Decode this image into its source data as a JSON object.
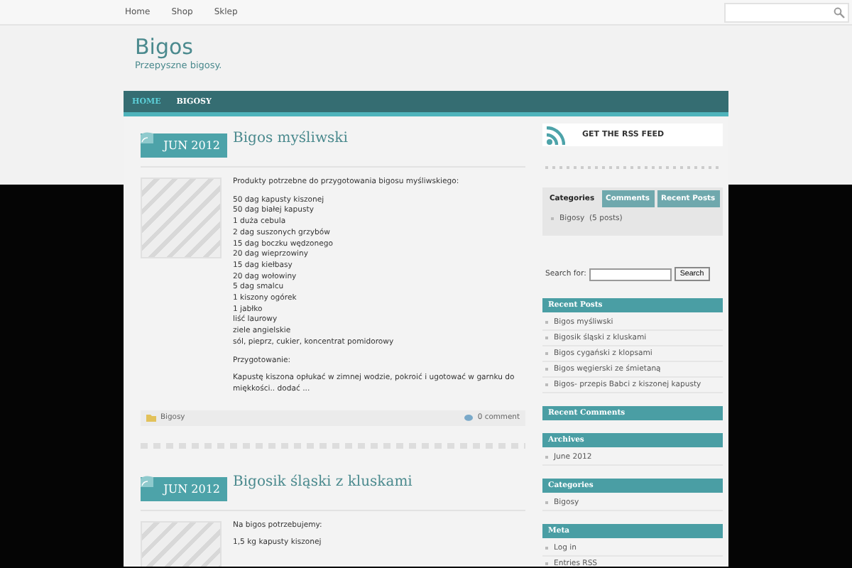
{
  "top_nav": [
    {
      "label": "Home"
    },
    {
      "label": "Shop"
    },
    {
      "label": "Sklep"
    }
  ],
  "site": {
    "title": "Bigos",
    "tagline": "Przepyszne bigosy."
  },
  "main_nav": [
    {
      "label": "HOME",
      "selected": true
    },
    {
      "label": "BIGOSY",
      "selected": false
    }
  ],
  "posts": [
    {
      "date": "JUN 2012",
      "title": "Bigos myśliwski",
      "paragraphs": [
        [
          "Produkty potrzebne do przygotowania bigosu myśliwskiego:"
        ],
        [
          "50 dag kapusty kiszonej",
          "50 dag białej kapusty",
          "1 duża cebula",
          "2 dag suszonych grzybów",
          "15 dag boczku wędzonego",
          "20 dag wieprzowiny",
          "15 dag kiełbasy",
          "20 dag wołowiny",
          "5 dag smalcu",
          "1 kiszony ogórek",
          "1 jabłko",
          "liść laurowy",
          "ziele angielskie",
          "sól, pieprz, cukier, koncentrat pomidorowy"
        ],
        [
          "Przygotowanie:"
        ],
        [
          "Kapustę kiszona opłukać w zimnej wodzie, pokroić i ugotować w garnku do miękkości.. dodać ..."
        ]
      ],
      "category": "Bigosy",
      "comments": "0 comment"
    },
    {
      "date": "JUN 2012",
      "title": "Bigosik śląski z kluskami",
      "paragraphs": [
        [
          "Na bigos potrzebujemy:"
        ],
        [
          "1,5 kg kapusty kiszonej"
        ]
      ]
    }
  ],
  "sidebar": {
    "rss": {
      "label": "GET THE RSS FEED"
    },
    "tabs": [
      {
        "label": "Categories",
        "selected": true
      },
      {
        "label": "Comments",
        "selected": false
      },
      {
        "label": "Recent Posts",
        "selected": false
      }
    ],
    "tab_items": [
      "Bigosy  (5 posts)"
    ],
    "search": {
      "label": "Search for:",
      "button": "Search"
    },
    "widgets": [
      {
        "title": "Recent Posts",
        "items": [
          "Bigos myśliwski",
          "Bigosik śląski z kluskami",
          "Bigos cygański z klopsami",
          "Bigos węgierski ze śmietaną",
          "Bigos- przepis Babci z kiszonej kapusty"
        ]
      },
      {
        "title": "Recent Comments"
      },
      {
        "title": "Archives",
        "items": [
          "June 2012"
        ]
      },
      {
        "title": "Categories",
        "items": [
          "Bigosy"
        ]
      },
      {
        "title": "Meta",
        "items": [
          "Log in",
          "Entries RSS"
        ]
      }
    ]
  }
}
